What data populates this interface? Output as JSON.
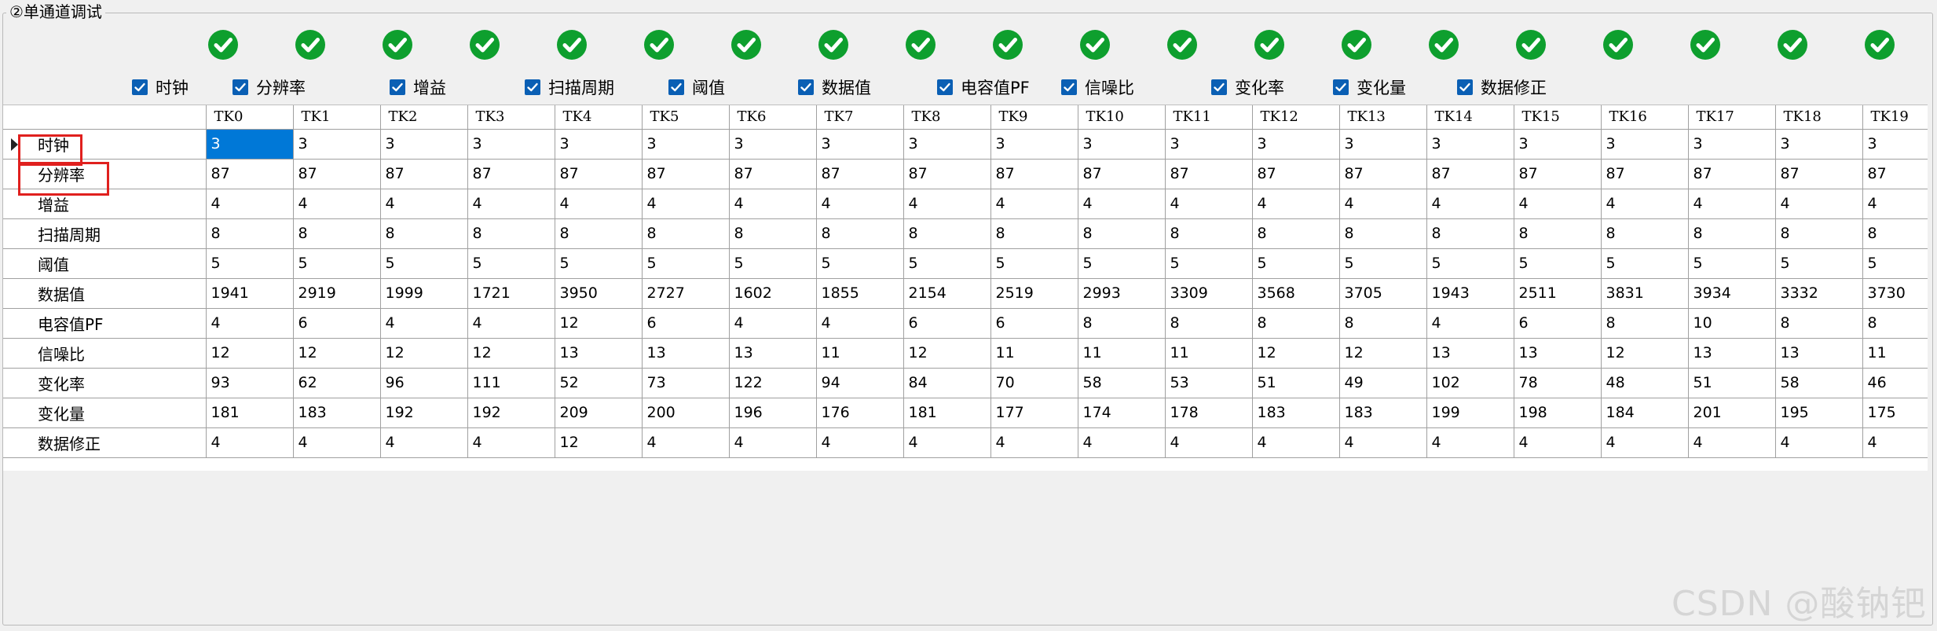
{
  "groupbox": {
    "title": "②单通道调试"
  },
  "status_icons": {
    "count": 20,
    "icon": "green-check-circle-icon",
    "color": "#0e9f2e"
  },
  "checkboxes": [
    {
      "label": "时钟",
      "checked": true
    },
    {
      "label": "分辨率",
      "checked": true
    },
    {
      "label": "增益",
      "checked": true
    },
    {
      "label": "扫描周期",
      "checked": true
    },
    {
      "label": "阈值",
      "checked": true
    },
    {
      "label": "数据值",
      "checked": true
    },
    {
      "label": "电容值PF",
      "checked": true
    },
    {
      "label": "信噪比",
      "checked": true
    },
    {
      "label": "变化率",
      "checked": true
    },
    {
      "label": "变化量",
      "checked": true
    },
    {
      "label": "数据修正",
      "checked": true
    }
  ],
  "table": {
    "columns": [
      "TK0",
      "TK1",
      "TK2",
      "TK3",
      "TK4",
      "TK5",
      "TK6",
      "TK7",
      "TK8",
      "TK9",
      "TK10",
      "TK11",
      "TK12",
      "TK13",
      "TK14",
      "TK15",
      "TK16",
      "TK17",
      "TK18",
      "TK19"
    ],
    "rows": [
      {
        "label": "时钟",
        "values": [
          "3",
          "3",
          "3",
          "3",
          "3",
          "3",
          "3",
          "3",
          "3",
          "3",
          "3",
          "3",
          "3",
          "3",
          "3",
          "3",
          "3",
          "3",
          "3",
          "3"
        ]
      },
      {
        "label": "分辨率",
        "values": [
          "87",
          "87",
          "87",
          "87",
          "87",
          "87",
          "87",
          "87",
          "87",
          "87",
          "87",
          "87",
          "87",
          "87",
          "87",
          "87",
          "87",
          "87",
          "87",
          "87"
        ]
      },
      {
        "label": "增益",
        "values": [
          "4",
          "4",
          "4",
          "4",
          "4",
          "4",
          "4",
          "4",
          "4",
          "4",
          "4",
          "4",
          "4",
          "4",
          "4",
          "4",
          "4",
          "4",
          "4",
          "4"
        ]
      },
      {
        "label": "扫描周期",
        "values": [
          "8",
          "8",
          "8",
          "8",
          "8",
          "8",
          "8",
          "8",
          "8",
          "8",
          "8",
          "8",
          "8",
          "8",
          "8",
          "8",
          "8",
          "8",
          "8",
          "8"
        ]
      },
      {
        "label": "阈值",
        "values": [
          "5",
          "5",
          "5",
          "5",
          "5",
          "5",
          "5",
          "5",
          "5",
          "5",
          "5",
          "5",
          "5",
          "5",
          "5",
          "5",
          "5",
          "5",
          "5",
          "5"
        ]
      },
      {
        "label": "数据值",
        "values": [
          "1941",
          "2919",
          "1999",
          "1721",
          "3950",
          "2727",
          "1602",
          "1855",
          "2154",
          "2519",
          "2993",
          "3309",
          "3568",
          "3705",
          "1943",
          "2511",
          "3831",
          "3934",
          "3332",
          "3730"
        ]
      },
      {
        "label": "电容值PF",
        "values": [
          "4",
          "6",
          "4",
          "4",
          "12",
          "6",
          "4",
          "4",
          "6",
          "6",
          "8",
          "8",
          "8",
          "8",
          "4",
          "6",
          "8",
          "10",
          "8",
          "8"
        ]
      },
      {
        "label": "信噪比",
        "values": [
          "12",
          "12",
          "12",
          "12",
          "13",
          "13",
          "13",
          "11",
          "12",
          "11",
          "11",
          "11",
          "12",
          "12",
          "13",
          "13",
          "12",
          "13",
          "13",
          "11"
        ]
      },
      {
        "label": "变化率",
        "values": [
          "93",
          "62",
          "96",
          "111",
          "52",
          "73",
          "122",
          "94",
          "84",
          "70",
          "58",
          "53",
          "51",
          "49",
          "102",
          "78",
          "48",
          "51",
          "58",
          "46"
        ]
      },
      {
        "label": "变化量",
        "values": [
          "181",
          "183",
          "192",
          "192",
          "209",
          "200",
          "196",
          "176",
          "181",
          "177",
          "174",
          "178",
          "183",
          "183",
          "199",
          "198",
          "184",
          "201",
          "195",
          "175"
        ]
      },
      {
        "label": "数据修正",
        "values": [
          "4",
          "4",
          "4",
          "4",
          "12",
          "4",
          "4",
          "4",
          "4",
          "4",
          "4",
          "4",
          "4",
          "4",
          "4",
          "4",
          "4",
          "4",
          "4",
          "4"
        ]
      }
    ],
    "current_row": 0,
    "selected_cell": {
      "row": 0,
      "col": 0
    }
  },
  "highlight_color": "#e0201e",
  "watermark": "CSDN @酸钠钯"
}
